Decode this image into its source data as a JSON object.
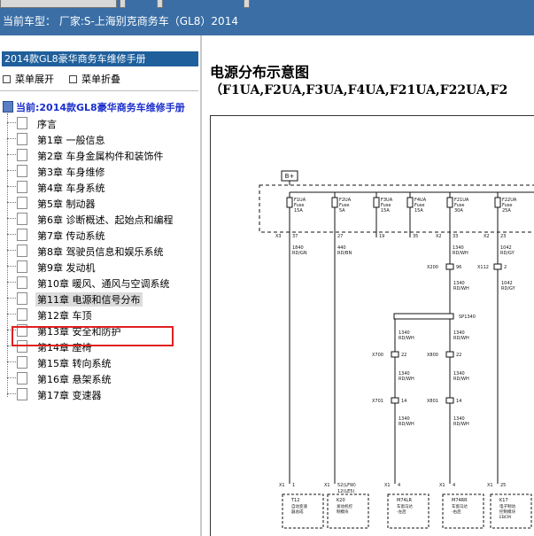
{
  "header": {
    "vehicle_info": "当前车型： 厂家:S-上海别克商务车（GL8）2014"
  },
  "sidebar": {
    "book_title": "2014款GL8豪华商务车维修手册",
    "expand_label": "菜单展开",
    "collapse_label": "菜单折叠",
    "current_label": "当前:2014款GL8豪华商务车维修手册",
    "items": [
      {
        "label": "序言"
      },
      {
        "label": "第1章 一般信息"
      },
      {
        "label": "第2章 车身金属构件和装饰件"
      },
      {
        "label": "第3章 车身维修"
      },
      {
        "label": "第4章 车身系统"
      },
      {
        "label": "第5章 制动器"
      },
      {
        "label": "第6章 诊断概述、起始点和编程"
      },
      {
        "label": "第7章 传动系统"
      },
      {
        "label": "第8章 驾驶员信息和娱乐系统"
      },
      {
        "label": "第9章 发动机"
      },
      {
        "label": "第10章 暖风、通风与空调系统"
      },
      {
        "label": "第11章 电源和信号分布"
      },
      {
        "label": "第12章 车顶"
      },
      {
        "label": "第13章 安全和防护"
      },
      {
        "label": "第14章 座椅"
      },
      {
        "label": "第15章 转向系统"
      },
      {
        "label": "第16章 悬架系统"
      },
      {
        "label": "第17章 变速器"
      }
    ],
    "selected_index": 11
  },
  "document": {
    "title": "电源分布示意图",
    "subtitle": "（F1UA,F2UA,F3UA,F4UA,F21UA,F22UA,F2"
  },
  "diagram": {
    "power_label": "B+",
    "fuses": [
      {
        "id": "F1UA",
        "type": "Fuse",
        "amp": "15A"
      },
      {
        "id": "F2UA",
        "type": "Fuse",
        "amp": "5A"
      },
      {
        "id": "F3UA",
        "type": "Fuse",
        "amp": "15A"
      },
      {
        "id": "F4UA",
        "type": "Fuse",
        "amp": "15A"
      },
      {
        "id": "F21UA",
        "type": "Fuse",
        "amp": "30A"
      },
      {
        "id": "F22UA",
        "type": "Fuse",
        "amp": "25A"
      }
    ],
    "connector_pins": [
      {
        "conn": "X3",
        "pin": "37"
      },
      {
        "pin": "27"
      },
      {
        "pin": "19"
      },
      {
        "pin": "35"
      },
      {
        "conn": "X2",
        "pin": "33"
      },
      {
        "conn": "X2",
        "pin": "23"
      }
    ],
    "wires_top": [
      {
        "num": "1840",
        "color": "RD/GN"
      },
      {
        "num": "440",
        "color": "RD/BN"
      },
      {
        "num": "1340",
        "color": "RD/WH"
      },
      {
        "num": "1042",
        "color": "RD/GY"
      }
    ],
    "inline_connectors": [
      {
        "conn": "X200",
        "pin": "96"
      },
      {
        "conn": "X112",
        "pin": "2"
      },
      {
        "conn": "X700",
        "pin": "22"
      },
      {
        "conn": "X800",
        "pin": "22"
      },
      {
        "conn": "X701",
        "pin": "14"
      },
      {
        "conn": "X801",
        "pin": "14"
      }
    ],
    "splice_label": "SP1340",
    "wire_1340": {
      "num": "1340",
      "color": "RD/WH"
    },
    "wire_1042": {
      "num": "1042",
      "color": "RD/GY"
    },
    "components": [
      {
        "pin_conn": "X1",
        "pin": "1",
        "ref": "T12",
        "desc1": "自动变速",
        "desc2": "器总成"
      },
      {
        "pin_conn": "X1",
        "pin": "52(LFW)",
        "pin2": "12(LE5)",
        "ref": "K20",
        "desc1": "发动机控",
        "desc2": "制模块"
      },
      {
        "pin_conn": "X1",
        "pin": "4",
        "ref": "M74LR",
        "desc1": "车窗马达",
        "desc2": "-左后"
      },
      {
        "pin_conn": "X1",
        "pin": "4",
        "ref": "M74RR",
        "desc1": "车窗马达",
        "desc2": "-右后"
      },
      {
        "pin_conn": "X1",
        "pin": "25",
        "ref": "K17",
        "desc1": "电子制动",
        "desc2": "控制模块",
        "desc3": "EBCM"
      }
    ]
  }
}
